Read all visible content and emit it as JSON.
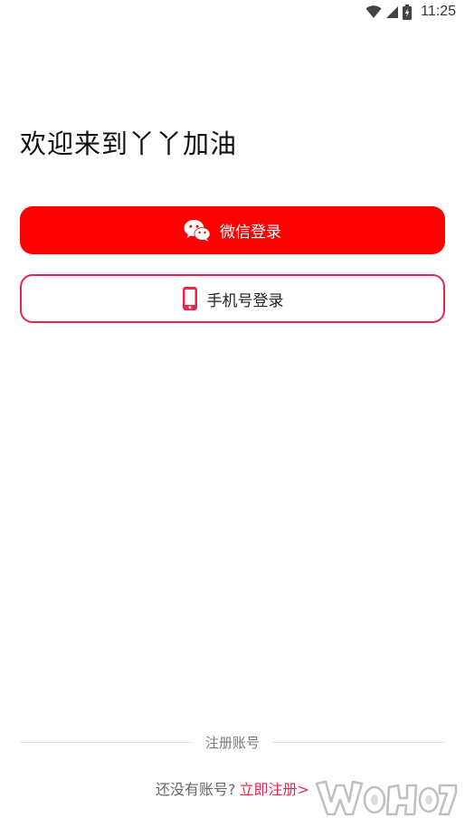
{
  "status_bar": {
    "time": "11:25",
    "wifi_icon": "wifi-icon",
    "signal_icon": "signal-icon",
    "battery_icon": "battery-charging-icon"
  },
  "welcome": {
    "title": "欢迎来到丫丫加油"
  },
  "buttons": {
    "wechat_login": "微信登录",
    "wechat_icon": "wechat-icon",
    "phone_login": "手机号登录",
    "phone_icon": "phone-icon"
  },
  "register": {
    "divider_label": "注册账号",
    "no_account": "还没有账号?",
    "register_now": "立即注册>"
  },
  "watermark": {
    "text": "",
    "icon": "site-logo-watermark"
  },
  "colors": {
    "primary": "#ff0000",
    "accent": "#e8264c",
    "text_dark": "#111111",
    "text_muted": "#777777",
    "divider": "#e2e2e2"
  }
}
